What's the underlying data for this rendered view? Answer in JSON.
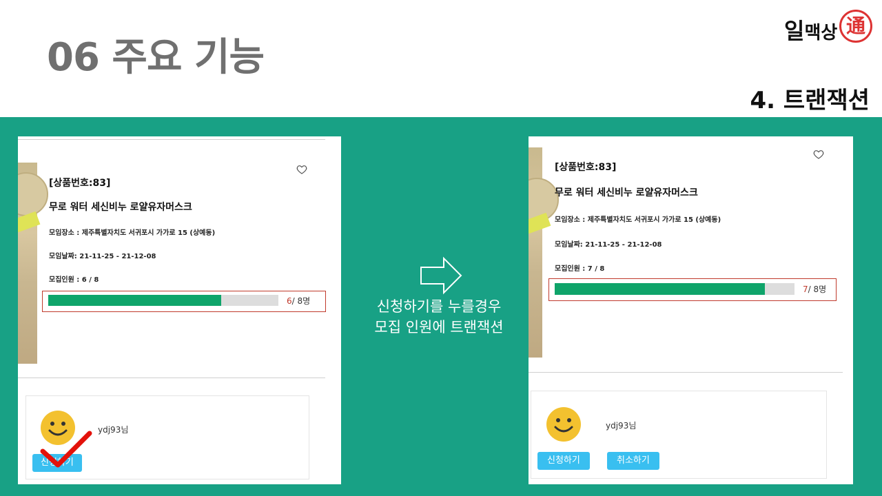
{
  "slide": {
    "title": "06 주요 기능",
    "section": "4. 트랜잭션",
    "logo": {
      "text_big": "일",
      "text_rest": "맥상",
      "seal": "通"
    },
    "caption_line1": "신청하기를 누를경우",
    "caption_line2": "모집 인원에 트랜잭션"
  },
  "colors": {
    "band": "#18a185",
    "progress_fill": "#0fa46a",
    "button": "#39bff0",
    "highlight": "#c0392b"
  },
  "before": {
    "product_id": "[상품번호:83]",
    "product_name": "무로 워터 세신비누 로얄유자머스크",
    "location": "모임장소 : 제주특별자치도 서귀포시 가가로 15 (상예동)",
    "dates": "모임날짜: 21-11-25 - 21-12-08",
    "recruit": "모집인원 : 6 / 8",
    "progress": {
      "current": "6",
      "rest": "/ 8명",
      "fraction": 0.75
    },
    "username": "ydj93님",
    "apply_label": "신청하기",
    "icons": {
      "heart": "heart-outline-icon",
      "avatar": "smiley-face-icon",
      "check": "red-checkmark-icon"
    }
  },
  "after": {
    "product_id": "[상품번호:83]",
    "product_name": "무로 워터 세신비누 로얄유자머스크",
    "location": "모임장소 : 제주특별자치도 서귀포시 가가로 15 (상예동)",
    "dates": "모임날짜: 21-11-25 - 21-12-08",
    "recruit": "모집인원 : 7 / 8",
    "progress": {
      "current": "7",
      "rest": "/ 8명",
      "fraction": 0.875
    },
    "username": "ydj93님",
    "apply_label": "신청하기",
    "cancel_label": "취소하기",
    "icons": {
      "heart": "heart-outline-icon",
      "avatar": "smiley-face-icon"
    }
  }
}
